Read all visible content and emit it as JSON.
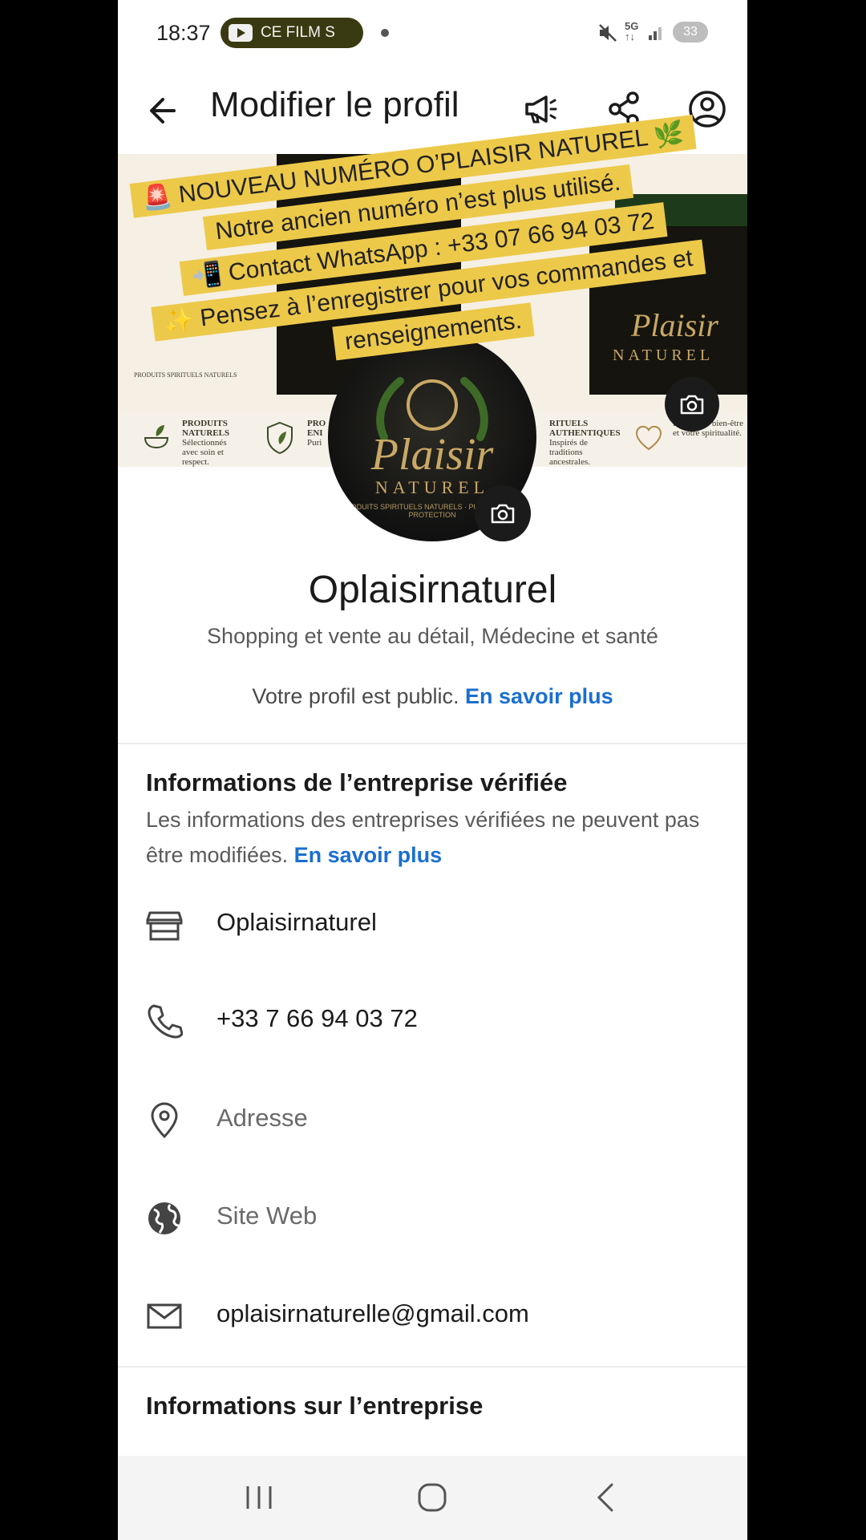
{
  "status_bar": {
    "time": "18:37",
    "media_pill_text": "CE FILM S",
    "network": "5G",
    "battery": "33"
  },
  "app_bar": {
    "title": "Modifier le profil"
  },
  "cover": {
    "features": [
      {
        "title": "PRODUITS NATURELS",
        "desc": "Sélectionnés avec soin et respect."
      },
      {
        "title": "PRO ENI",
        "desc": "Puri"
      },
      {
        "title": "RITUELS AUTHENTIQUES",
        "desc": "Inspirés de traditions ancestrales."
      },
      {
        "title": "",
        "desc": "Pour votre bien-être et votre spiritualité."
      }
    ],
    "brand_script": "Plaisir",
    "brand_word": "NATUREL",
    "brand_tagline": "PRODUITS SPIRITUELS NATURELS"
  },
  "banner": {
    "line1": "🚨 NOUVEAU NUMÉRO O’PLAISIR NATUREL 🌿",
    "line2": "Notre ancien numéro n’est plus utilisé.",
    "line3": "📲 Contact WhatsApp : +33 07 66 94 03 72",
    "line4": "✨ Pensez à l’enregistrer pour vos commandes et",
    "line5": "renseignements."
  },
  "avatar": {
    "script": "Plaisir",
    "word": "NATUREL",
    "tagline": "PRODUITS SPIRITUELS NATURELS · PURIFICATION · PROTECTION"
  },
  "profile": {
    "name": "Oplaisirnaturel",
    "category": "Shopping et vente au détail, Médecine et santé",
    "public_text": "Votre profil est public. ",
    "public_link": "En savoir plus"
  },
  "verified": {
    "title": "Informations de l’entreprise vérifiée",
    "desc": "Les informations des entreprises vérifiées ne peuvent pas être modifiées. ",
    "link": "En savoir plus"
  },
  "fields": {
    "business_name": "Oplaisirnaturel",
    "phone": "+33 7 66 94 03 72",
    "address": "Adresse",
    "website": "Site Web",
    "email": "oplaisirnaturelle@gmail.com"
  },
  "info_section": {
    "title": "Informations sur l’entreprise"
  },
  "icons": [
    "back-arrow-icon",
    "megaphone-icon",
    "share-icon",
    "account-circle-icon",
    "camera-icon",
    "store-icon",
    "phone-icon",
    "location-pin-icon",
    "globe-icon",
    "mail-icon"
  ],
  "colors": {
    "accent_link": "#1a6fd1",
    "banner": "#edc94a",
    "brand_gold": "#c9a865"
  }
}
